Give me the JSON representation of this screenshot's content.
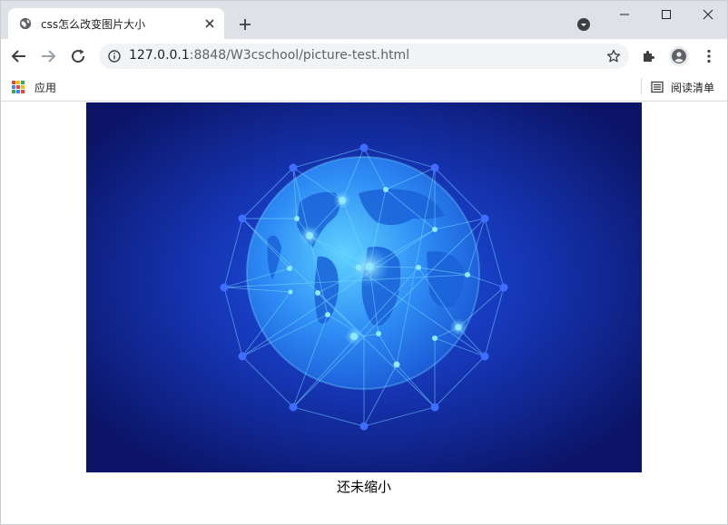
{
  "tab": {
    "title": "css怎么改变图片大小",
    "favicon": "globe-icon"
  },
  "address_bar": {
    "host": "127.0.0.1",
    "path": ":8848/W3cschool/picture-test.html"
  },
  "bookmarks": {
    "apps_label": "应用",
    "reading_list_label": "阅读清单"
  },
  "content": {
    "caption": "还未缩小"
  },
  "colors": {
    "tabstrip": "#dee1e6",
    "omnibox": "#f1f3f4",
    "image_bg": "#0b1a6e",
    "globe": "#2f8bff"
  }
}
